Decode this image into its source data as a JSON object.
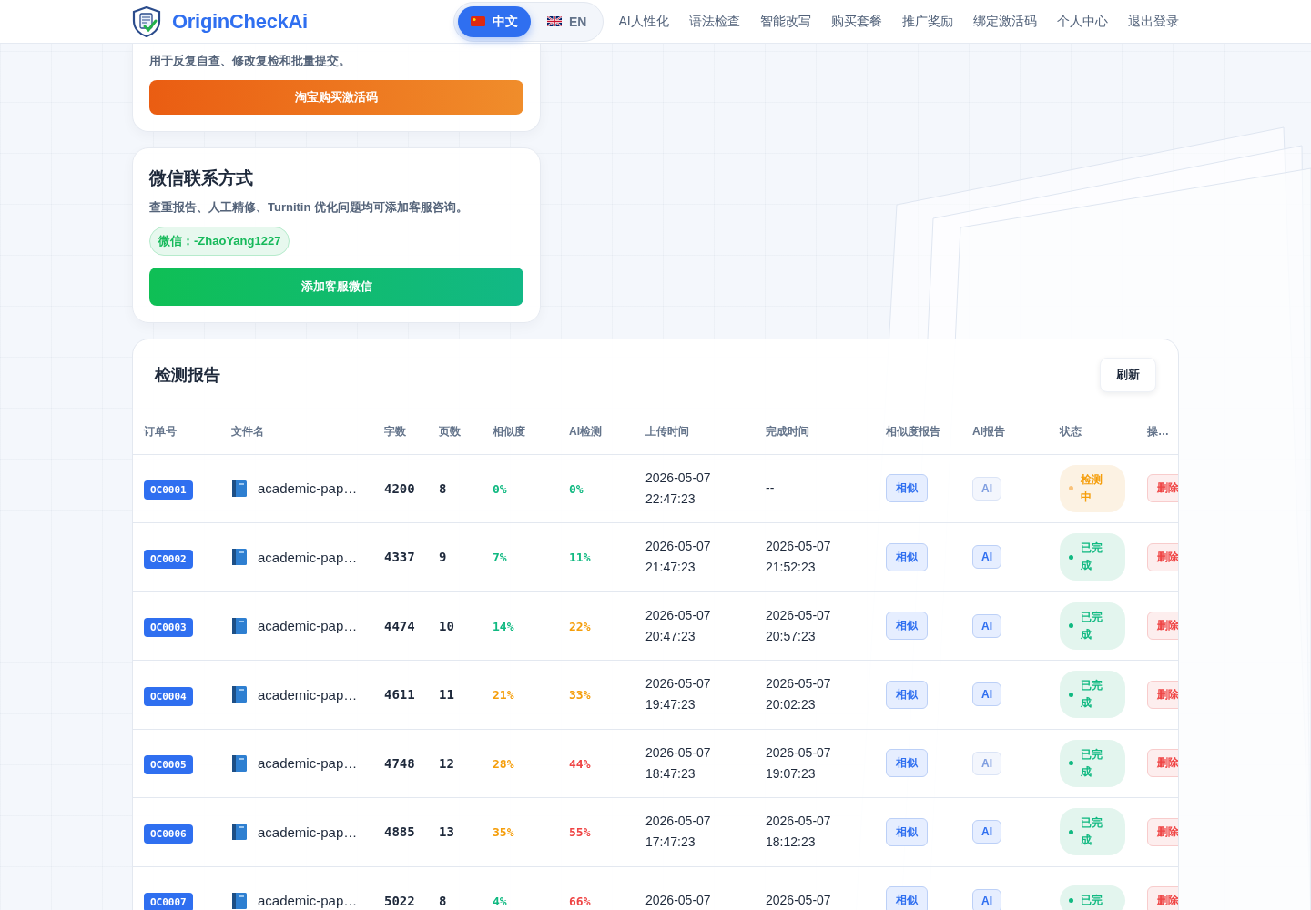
{
  "header": {
    "brand": "OriginCheckAi",
    "languages": [
      {
        "label": "中文",
        "kind": "cn",
        "selected": true
      },
      {
        "label": "EN",
        "kind": "uk",
        "selected": false
      }
    ],
    "nav": [
      "AI人性化",
      "语法检查",
      "智能改写",
      "购买套餐",
      "推广奖励",
      "绑定激活码",
      "个人中心",
      "退出登录"
    ]
  },
  "purchase_card": {
    "description": "用于反复自查、修改复检和批量提交。",
    "button": "淘宝购买激活码"
  },
  "wechat_card": {
    "title": "微信联系方式",
    "description": "查重报告、人工精修、Turnitin 优化问题均可添加客服咨询。",
    "wechat_id": "微信：-ZhaoYang1227",
    "button": "添加客服微信"
  },
  "reports": {
    "title": "检测报告",
    "refresh": "刷新",
    "columns": [
      "订单号",
      "文件名",
      "字数",
      "页数",
      "相似度",
      "AI检测",
      "上传时间",
      "完成时间",
      "相似度报告",
      "AI报告",
      "状态",
      "操…"
    ],
    "rows": [
      {
        "order": "OC0001",
        "file": "academic-pap…",
        "words": "4200",
        "pages": "8",
        "similarity": {
          "text": "0%",
          "color": "#10b981"
        },
        "ai": {
          "text": "0%",
          "color": "#10b981"
        },
        "uploaded": "2026-05-07 22:47:23",
        "completed": "--",
        "similarity_report": "相似",
        "ai_report": {
          "label": "AI",
          "disabled": true
        },
        "status": {
          "kind": "checking",
          "label": "检测中"
        },
        "action": "删除"
      },
      {
        "order": "OC0002",
        "file": "academic-pap…",
        "words": "4337",
        "pages": "9",
        "similarity": {
          "text": "7%",
          "color": "#10b981"
        },
        "ai": {
          "text": "11%",
          "color": "#10b981"
        },
        "uploaded": "2026-05-07 21:47:23",
        "completed": "2026-05-07 21:52:23",
        "similarity_report": "相似",
        "ai_report": {
          "label": "AI",
          "disabled": false
        },
        "status": {
          "kind": "done",
          "label": "已完成"
        },
        "action": "删除"
      },
      {
        "order": "OC0003",
        "file": "academic-pap…",
        "words": "4474",
        "pages": "10",
        "similarity": {
          "text": "14%",
          "color": "#10b981"
        },
        "ai": {
          "text": "22%",
          "color": "#f59e0b"
        },
        "uploaded": "2026-05-07 20:47:23",
        "completed": "2026-05-07 20:57:23",
        "similarity_report": "相似",
        "ai_report": {
          "label": "AI",
          "disabled": false
        },
        "status": {
          "kind": "done",
          "label": "已完成"
        },
        "action": "删除"
      },
      {
        "order": "OC0004",
        "file": "academic-pap…",
        "words": "4611",
        "pages": "11",
        "similarity": {
          "text": "21%",
          "color": "#f59e0b"
        },
        "ai": {
          "text": "33%",
          "color": "#f59e0b"
        },
        "uploaded": "2026-05-07 19:47:23",
        "completed": "2026-05-07 20:02:23",
        "similarity_report": "相似",
        "ai_report": {
          "label": "AI",
          "disabled": false
        },
        "status": {
          "kind": "done",
          "label": "已完成"
        },
        "action": "删除"
      },
      {
        "order": "OC0005",
        "file": "academic-pap…",
        "words": "4748",
        "pages": "12",
        "similarity": {
          "text": "28%",
          "color": "#f59e0b"
        },
        "ai": {
          "text": "44%",
          "color": "#ef4444"
        },
        "uploaded": "2026-05-07 18:47:23",
        "completed": "2026-05-07 19:07:23",
        "similarity_report": "相似",
        "ai_report": {
          "label": "AI",
          "disabled": true
        },
        "status": {
          "kind": "done",
          "label": "已完成"
        },
        "action": "删除"
      },
      {
        "order": "OC0006",
        "file": "academic-pap…",
        "words": "4885",
        "pages": "13",
        "similarity": {
          "text": "35%",
          "color": "#f59e0b"
        },
        "ai": {
          "text": "55%",
          "color": "#ef4444"
        },
        "uploaded": "2026-05-07 17:47:23",
        "completed": "2026-05-07 18:12:23",
        "similarity_report": "相似",
        "ai_report": {
          "label": "AI",
          "disabled": false
        },
        "status": {
          "kind": "done",
          "label": "已完成"
        },
        "action": "删除"
      },
      {
        "order": "OC0007",
        "file": "academic-pap…",
        "words": "5022",
        "pages": "8",
        "similarity": {
          "text": "4%",
          "color": "#10b981"
        },
        "ai": {
          "text": "66%",
          "color": "#ef4444"
        },
        "uploaded": "2026-05-07",
        "completed": "2026-05-07",
        "similarity_report": "相似",
        "ai_report": {
          "label": "AI",
          "disabled": false
        },
        "status": {
          "kind": "done",
          "label": "已完"
        },
        "action": "删除"
      }
    ]
  }
}
